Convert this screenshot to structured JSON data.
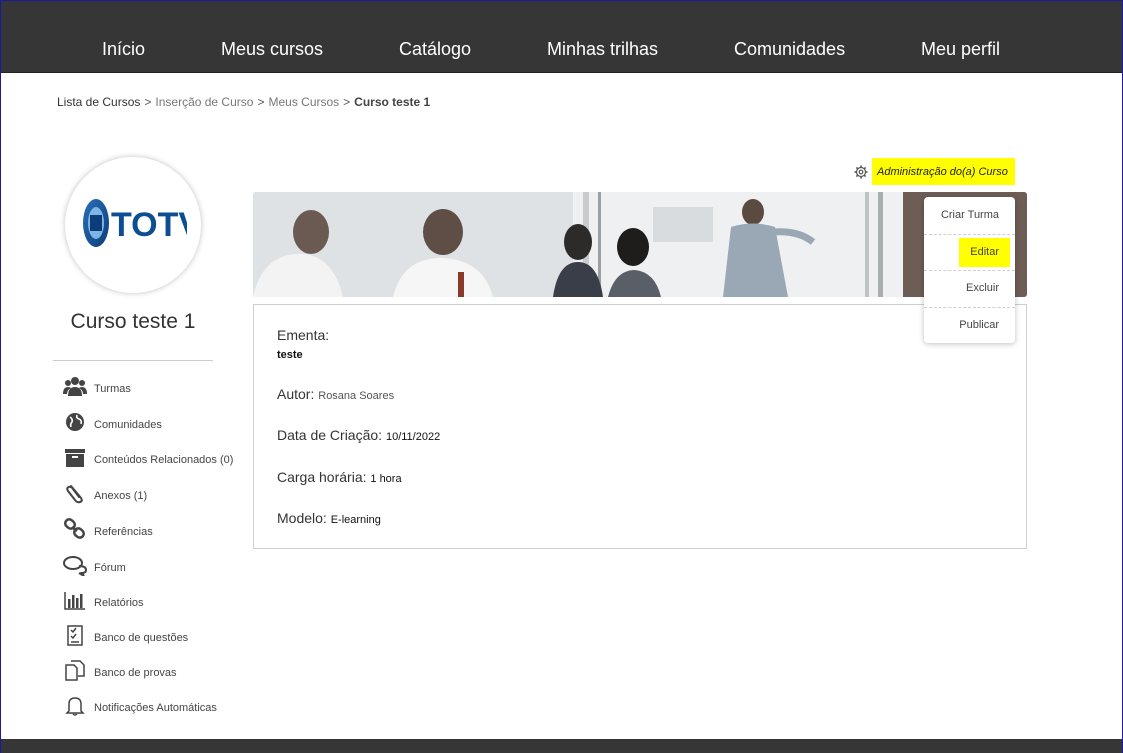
{
  "nav": {
    "items": [
      "Início",
      "Meus cursos",
      "Catálogo",
      "Minhas trilhas",
      "Comunidades",
      "Meu perfil"
    ]
  },
  "breadcrumb": {
    "items": [
      "Lista de Cursos",
      "Inserção de Curso",
      "Meus Cursos"
    ],
    "separator": ">",
    "current": "Curso teste 1"
  },
  "course": {
    "logo_text": "TOTVS",
    "title": "Curso teste 1"
  },
  "sidebar": {
    "items": [
      {
        "label": "Turmas",
        "icon": "users-icon"
      },
      {
        "label": "Comunidades",
        "icon": "globe-icon"
      },
      {
        "label": "Conteúdos Relacionados (0)",
        "icon": "archive-box-icon"
      },
      {
        "label": "Anexos (1)",
        "icon": "paperclip-icon"
      },
      {
        "label": "Referências",
        "icon": "link-icon"
      },
      {
        "label": "Fórum",
        "icon": "chat-bubbles-icon"
      },
      {
        "label": "Relatórios",
        "icon": "bar-chart-icon"
      },
      {
        "label": "Banco de questões",
        "icon": "checklist-icon"
      },
      {
        "label": "Banco de provas",
        "icon": "documents-icon"
      },
      {
        "label": "Notificações Automáticas",
        "icon": "bell-icon"
      }
    ]
  },
  "admin": {
    "link_label": "Administração do(a) Curso",
    "icon": "gear-icon",
    "highlight_color": "#ffff00"
  },
  "dropdown": {
    "items": [
      "Criar Turma",
      "Editar",
      "Excluir",
      "Publicar"
    ],
    "highlighted": "Editar"
  },
  "info": {
    "ementa_label": "Ementa:",
    "ementa_value": "teste",
    "autor_label": "Autor:",
    "autor_value": "Rosana Soares",
    "data_label": "Data de Criação:",
    "data_value": "10/11/2022",
    "carga_label": "Carga horária:",
    "carga_value": "1 hora",
    "modelo_label": "Modelo:",
    "modelo_value": "E-learning"
  }
}
